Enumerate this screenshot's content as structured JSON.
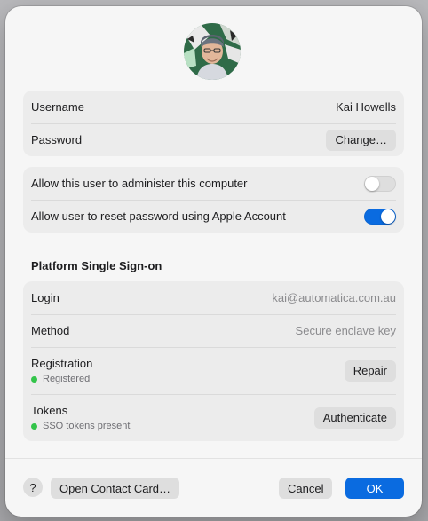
{
  "account": {
    "username_label": "Username",
    "username_value": "Kai Howells",
    "password_label": "Password",
    "change_button": "Change…"
  },
  "permissions": {
    "admin_label": "Allow this user to administer this computer",
    "admin_enabled": false,
    "reset_label": "Allow user to reset password using Apple Account",
    "reset_enabled": true
  },
  "sso": {
    "title": "Platform Single Sign-on",
    "login_label": "Login",
    "login_value": "kai@automatica.com.au",
    "method_label": "Method",
    "method_value": "Secure enclave key",
    "registration_label": "Registration",
    "registration_status": "Registered",
    "repair_button": "Repair",
    "tokens_label": "Tokens",
    "tokens_status": "SSO tokens present",
    "authenticate_button": "Authenticate"
  },
  "footer": {
    "help_label": "?",
    "contact_card_button": "Open Contact Card…",
    "cancel_button": "Cancel",
    "ok_button": "OK"
  },
  "colors": {
    "accent": "#0a6be0",
    "status_ok": "#33c44a"
  }
}
